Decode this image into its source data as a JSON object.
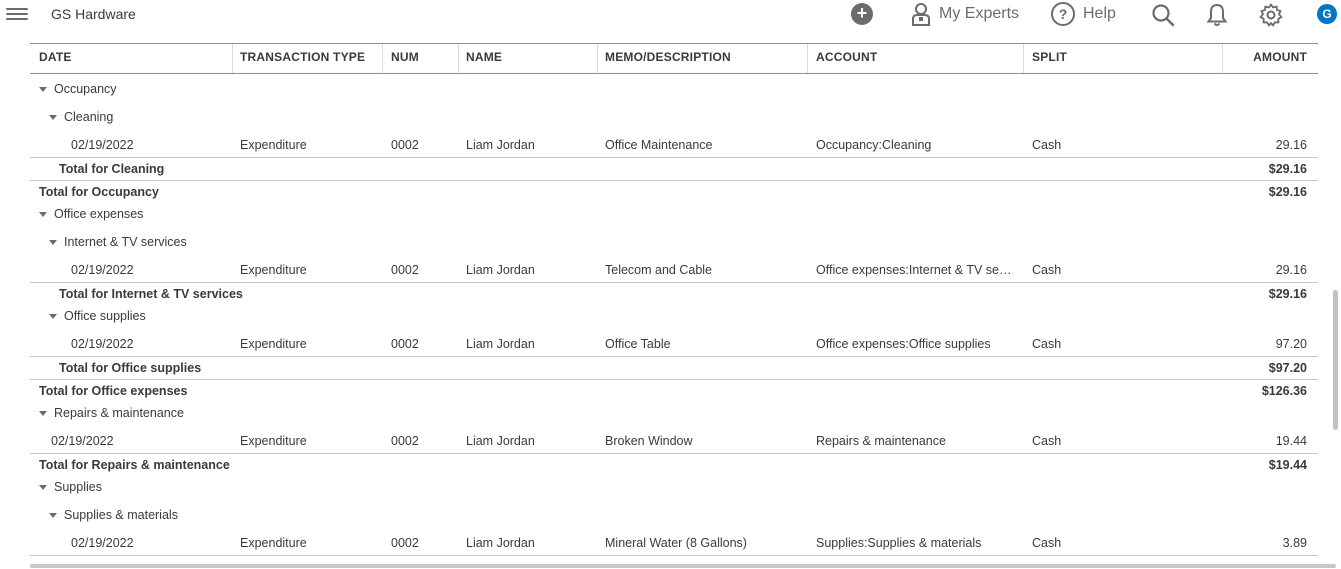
{
  "app": {
    "company": "GS Hardware",
    "experts_label": "My Experts",
    "help_label": "Help",
    "help_glyph": "?",
    "plus_glyph": "+",
    "avatar_initial": "G",
    "accent": "#0077c5",
    "icon_color": "#6b6c72"
  },
  "columns": [
    "DATE",
    "TRANSACTION TYPE",
    "NUM",
    "NAME",
    "MEMO/DESCRIPTION",
    "ACCOUNT",
    "SPLIT",
    "AMOUNT"
  ],
  "rows": {
    "occupancy": "Occupancy",
    "cleaning": "Cleaning",
    "r1": [
      "02/19/2022",
      "Expenditure",
      "0002",
      "Liam Jordan",
      "Office Maintenance",
      "Occupancy:Cleaning",
      "Cash",
      "29.16"
    ],
    "total_cleaning": [
      "Total for Cleaning",
      "$29.16"
    ],
    "total_occupancy": [
      "Total for Occupancy",
      "$29.16"
    ],
    "office_expenses": "Office expenses",
    "internet": "Internet & TV services",
    "r2": [
      "02/19/2022",
      "Expenditure",
      "0002",
      "Liam Jordan",
      "Telecom and Cable",
      "Office expenses:Internet & TV se…",
      "Cash",
      "29.16"
    ],
    "total_internet": [
      "Total for Internet & TV services",
      "$29.16"
    ],
    "office_supplies": "Office supplies",
    "r3": [
      "02/19/2022",
      "Expenditure",
      "0002",
      "Liam Jordan",
      "Office Table",
      "Office expenses:Office supplies",
      "Cash",
      "97.20"
    ],
    "total_office_supplies": [
      "Total for Office supplies",
      "$97.20"
    ],
    "total_office_expenses": [
      "Total for Office expenses",
      "$126.36"
    ],
    "repairs": "Repairs & maintenance",
    "r4": [
      "02/19/2022",
      "Expenditure",
      "0002",
      "Liam Jordan",
      "Broken Window",
      "Repairs & maintenance",
      "Cash",
      "19.44"
    ],
    "total_repairs": [
      "Total for Repairs & maintenance",
      "$19.44"
    ],
    "supplies": "Supplies",
    "supplies_materials": "Supplies & materials",
    "r5": [
      "02/19/2022",
      "Expenditure",
      "0002",
      "Liam Jordan",
      "Mineral Water (8 Gallons)",
      "Supplies:Supplies & materials",
      "Cash",
      "3.89"
    ]
  }
}
